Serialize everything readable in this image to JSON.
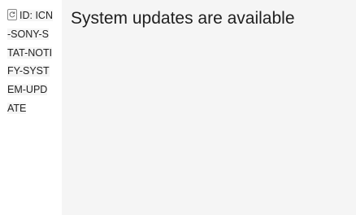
{
  "id_label": {
    "icon": "sync-icon",
    "text": "ID: ICN-SONY-STAT-NOTIFY-SYSTEM-UPDATE"
  },
  "notification": {
    "message": "System updates are available"
  }
}
